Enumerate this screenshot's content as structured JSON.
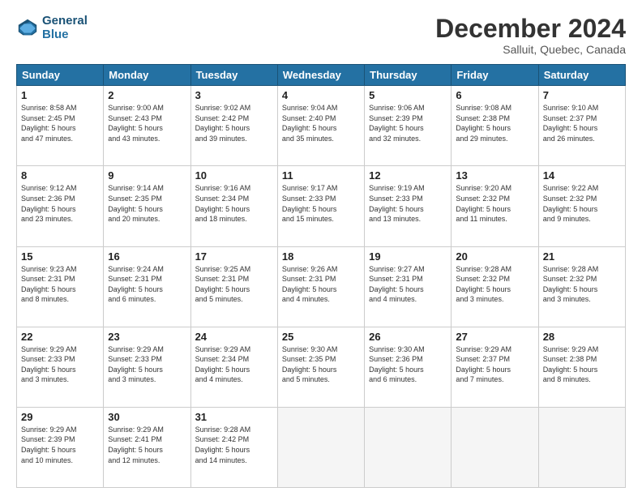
{
  "header": {
    "logo_line1": "General",
    "logo_line2": "Blue",
    "title": "December 2024",
    "subtitle": "Salluit, Quebec, Canada"
  },
  "weekdays": [
    "Sunday",
    "Monday",
    "Tuesday",
    "Wednesday",
    "Thursday",
    "Friday",
    "Saturday"
  ],
  "weeks": [
    [
      {
        "day": "1",
        "info": "Sunrise: 8:58 AM\nSunset: 2:45 PM\nDaylight: 5 hours\nand 47 minutes."
      },
      {
        "day": "2",
        "info": "Sunrise: 9:00 AM\nSunset: 2:43 PM\nDaylight: 5 hours\nand 43 minutes."
      },
      {
        "day": "3",
        "info": "Sunrise: 9:02 AM\nSunset: 2:42 PM\nDaylight: 5 hours\nand 39 minutes."
      },
      {
        "day": "4",
        "info": "Sunrise: 9:04 AM\nSunset: 2:40 PM\nDaylight: 5 hours\nand 35 minutes."
      },
      {
        "day": "5",
        "info": "Sunrise: 9:06 AM\nSunset: 2:39 PM\nDaylight: 5 hours\nand 32 minutes."
      },
      {
        "day": "6",
        "info": "Sunrise: 9:08 AM\nSunset: 2:38 PM\nDaylight: 5 hours\nand 29 minutes."
      },
      {
        "day": "7",
        "info": "Sunrise: 9:10 AM\nSunset: 2:37 PM\nDaylight: 5 hours\nand 26 minutes."
      }
    ],
    [
      {
        "day": "8",
        "info": "Sunrise: 9:12 AM\nSunset: 2:36 PM\nDaylight: 5 hours\nand 23 minutes."
      },
      {
        "day": "9",
        "info": "Sunrise: 9:14 AM\nSunset: 2:35 PM\nDaylight: 5 hours\nand 20 minutes."
      },
      {
        "day": "10",
        "info": "Sunrise: 9:16 AM\nSunset: 2:34 PM\nDaylight: 5 hours\nand 18 minutes."
      },
      {
        "day": "11",
        "info": "Sunrise: 9:17 AM\nSunset: 2:33 PM\nDaylight: 5 hours\nand 15 minutes."
      },
      {
        "day": "12",
        "info": "Sunrise: 9:19 AM\nSunset: 2:33 PM\nDaylight: 5 hours\nand 13 minutes."
      },
      {
        "day": "13",
        "info": "Sunrise: 9:20 AM\nSunset: 2:32 PM\nDaylight: 5 hours\nand 11 minutes."
      },
      {
        "day": "14",
        "info": "Sunrise: 9:22 AM\nSunset: 2:32 PM\nDaylight: 5 hours\nand 9 minutes."
      }
    ],
    [
      {
        "day": "15",
        "info": "Sunrise: 9:23 AM\nSunset: 2:31 PM\nDaylight: 5 hours\nand 8 minutes."
      },
      {
        "day": "16",
        "info": "Sunrise: 9:24 AM\nSunset: 2:31 PM\nDaylight: 5 hours\nand 6 minutes."
      },
      {
        "day": "17",
        "info": "Sunrise: 9:25 AM\nSunset: 2:31 PM\nDaylight: 5 hours\nand 5 minutes."
      },
      {
        "day": "18",
        "info": "Sunrise: 9:26 AM\nSunset: 2:31 PM\nDaylight: 5 hours\nand 4 minutes."
      },
      {
        "day": "19",
        "info": "Sunrise: 9:27 AM\nSunset: 2:31 PM\nDaylight: 5 hours\nand 4 minutes."
      },
      {
        "day": "20",
        "info": "Sunrise: 9:28 AM\nSunset: 2:32 PM\nDaylight: 5 hours\nand 3 minutes."
      },
      {
        "day": "21",
        "info": "Sunrise: 9:28 AM\nSunset: 2:32 PM\nDaylight: 5 hours\nand 3 minutes."
      }
    ],
    [
      {
        "day": "22",
        "info": "Sunrise: 9:29 AM\nSunset: 2:33 PM\nDaylight: 5 hours\nand 3 minutes."
      },
      {
        "day": "23",
        "info": "Sunrise: 9:29 AM\nSunset: 2:33 PM\nDaylight: 5 hours\nand 3 minutes."
      },
      {
        "day": "24",
        "info": "Sunrise: 9:29 AM\nSunset: 2:34 PM\nDaylight: 5 hours\nand 4 minutes."
      },
      {
        "day": "25",
        "info": "Sunrise: 9:30 AM\nSunset: 2:35 PM\nDaylight: 5 hours\nand 5 minutes."
      },
      {
        "day": "26",
        "info": "Sunrise: 9:30 AM\nSunset: 2:36 PM\nDaylight: 5 hours\nand 6 minutes."
      },
      {
        "day": "27",
        "info": "Sunrise: 9:29 AM\nSunset: 2:37 PM\nDaylight: 5 hours\nand 7 minutes."
      },
      {
        "day": "28",
        "info": "Sunrise: 9:29 AM\nSunset: 2:38 PM\nDaylight: 5 hours\nand 8 minutes."
      }
    ],
    [
      {
        "day": "29",
        "info": "Sunrise: 9:29 AM\nSunset: 2:39 PM\nDaylight: 5 hours\nand 10 minutes."
      },
      {
        "day": "30",
        "info": "Sunrise: 9:29 AM\nSunset: 2:41 PM\nDaylight: 5 hours\nand 12 minutes."
      },
      {
        "day": "31",
        "info": "Sunrise: 9:28 AM\nSunset: 2:42 PM\nDaylight: 5 hours\nand 14 minutes."
      },
      {
        "day": "",
        "info": ""
      },
      {
        "day": "",
        "info": ""
      },
      {
        "day": "",
        "info": ""
      },
      {
        "day": "",
        "info": ""
      }
    ]
  ]
}
